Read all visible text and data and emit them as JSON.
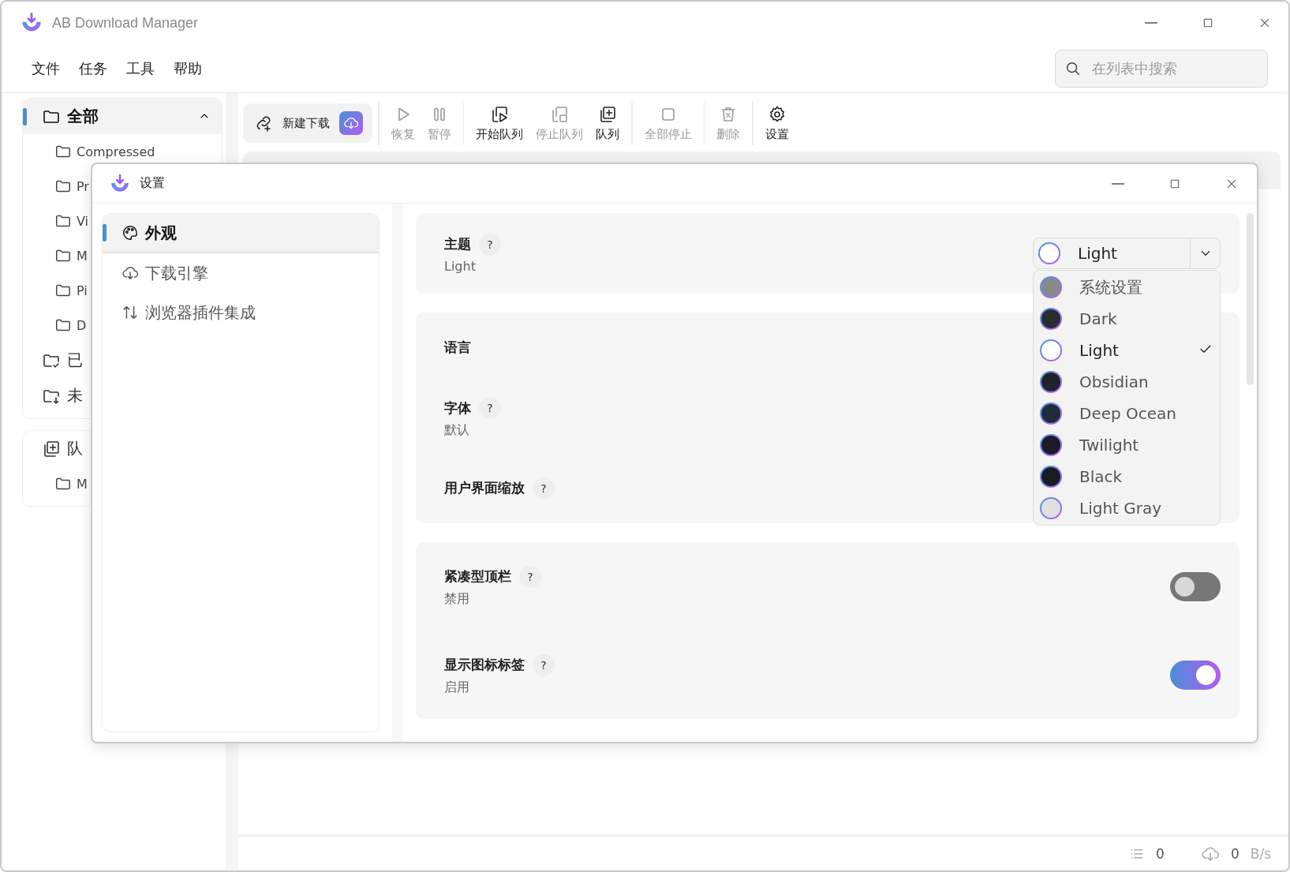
{
  "window": {
    "title": "AB Download Manager",
    "menu": [
      "文件",
      "任务",
      "工具",
      "帮助"
    ],
    "search": {
      "placeholder": "在列表中搜索"
    }
  },
  "sidebar": {
    "groups": [
      {
        "items": [
          {
            "label": "全部",
            "kind": "category",
            "selected": true,
            "expanded": true,
            "children": [
              {
                "label": "Compressed"
              },
              {
                "label": "Pr"
              },
              {
                "label": "Vi"
              },
              {
                "label": "M"
              },
              {
                "label": "Pi"
              },
              {
                "label": "D"
              }
            ]
          },
          {
            "label": "已",
            "kind": "completed",
            "selected": false
          },
          {
            "label": "未",
            "kind": "unfinished",
            "selected": false
          }
        ]
      },
      {
        "items": [
          {
            "label": "队",
            "kind": "queue",
            "selected": false,
            "children": [
              {
                "label": "M"
              }
            ]
          }
        ]
      }
    ]
  },
  "toolbar": {
    "new_download": {
      "label": "新建下载"
    },
    "groups": [
      [
        {
          "label": "恢复",
          "kind": "resume",
          "disabled": true
        },
        {
          "label": "暂停",
          "kind": "pause",
          "disabled": true
        }
      ],
      [
        {
          "label": "开始队列",
          "kind": "startqueue",
          "disabled": false
        },
        {
          "label": "停止队列",
          "kind": "stopqueue",
          "disabled": true
        },
        {
          "label": "队列",
          "kind": "queue",
          "disabled": false
        }
      ],
      [
        {
          "label": "全部停止",
          "kind": "stopall",
          "disabled": true
        }
      ],
      [
        {
          "label": "删除",
          "kind": "delete",
          "disabled": true
        }
      ],
      [
        {
          "label": "设置",
          "kind": "settings",
          "disabled": false
        }
      ]
    ]
  },
  "status_bar": {
    "queue_count": "0",
    "speed": "0",
    "speed_unit": "B/s"
  },
  "settings_dialog": {
    "title": "设置",
    "nav": [
      {
        "label": "外观",
        "kind": "appearance",
        "selected": true
      },
      {
        "label": "下载引擎",
        "kind": "engine",
        "selected": false
      },
      {
        "label": "浏览器插件集成",
        "kind": "browser",
        "selected": false
      }
    ],
    "sections": [
      {
        "rows": [
          {
            "kind": "select",
            "label": "主题",
            "help": "?",
            "value": "Light",
            "control": {
              "value": "Light",
              "color": "#ffffff"
            }
          }
        ]
      },
      {
        "rows": [
          {
            "kind": "plain",
            "label": "语言"
          },
          {
            "kind": "plain",
            "label": "字体",
            "help": "?",
            "value": "默认"
          },
          {
            "kind": "plain",
            "label": "用户界面缩放",
            "help": "?"
          }
        ]
      },
      {
        "rows": [
          {
            "kind": "toggle",
            "label": "紧凑型顶栏",
            "help": "?",
            "value": "禁用",
            "on": false
          },
          {
            "kind": "toggle",
            "label": "显示图标标签",
            "help": "?",
            "value": "启用",
            "on": true
          }
        ]
      }
    ],
    "theme_menu": [
      {
        "label": "系统设置",
        "color": "#8a8a8a",
        "selected": false
      },
      {
        "label": "Dark",
        "color": "#2b2b30",
        "selected": false
      },
      {
        "label": "Light",
        "color": "#ffffff",
        "selected": true
      },
      {
        "label": "Obsidian",
        "color": "#22222a",
        "selected": false
      },
      {
        "label": "Deep Ocean",
        "color": "#1f2b3a",
        "selected": false
      },
      {
        "label": "Twilight",
        "color": "#1c1a2a",
        "selected": false
      },
      {
        "label": "Black",
        "color": "#181c22",
        "selected": false
      },
      {
        "label": "Light Gray",
        "color": "#e0e0e0",
        "selected": false
      }
    ]
  }
}
